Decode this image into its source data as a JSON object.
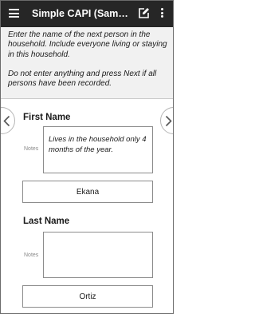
{
  "app": {
    "title": "Simple CAPI (Sample..."
  },
  "icons": {
    "menu": "menu-icon",
    "edit": "edit-icon",
    "more": "more-vert-icon",
    "prev": "chevron-left-icon",
    "next": "chevron-right-icon"
  },
  "instructions": {
    "line1": "Enter the name of the next person in the household. Include everyone living or staying in this household.",
    "line2": "Do not enter anything and press Next if all persons have been recorded."
  },
  "questions": [
    {
      "label": "First Name",
      "notes_label": "Notes",
      "notes_value": "Lives in the household only 4 months of the year.",
      "answer": "Ekana"
    },
    {
      "label": "Last Name",
      "notes_label": "Notes",
      "notes_value": "",
      "answer": "Ortiz"
    }
  ],
  "colors": {
    "appbar": "#262626",
    "instruction_bg": "#f1f1f1",
    "border": "#8c8c8c"
  }
}
